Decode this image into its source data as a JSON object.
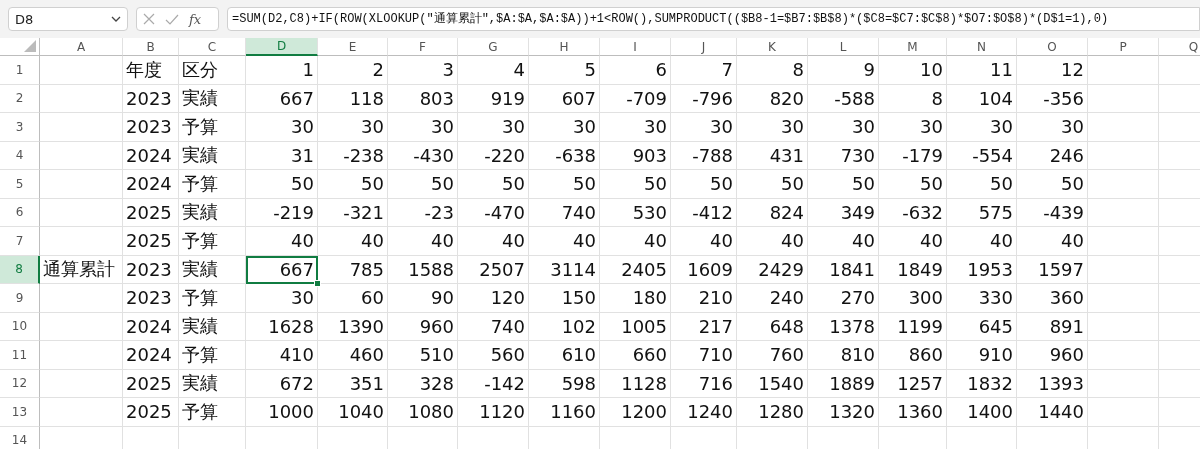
{
  "formula_bar": {
    "name_box": "D8",
    "fx": "fx",
    "formula": "=SUM(D2,C8)+IF(ROW(XLOOKUP(\"通算累計\",$A:$A,$A:$A))+1<ROW(),SUMPRODUCT(($B8-1=$B7:$B$8)*($C8=$C7:$C$8)*$O7:$O$8)*(D$1=1),0)"
  },
  "columns": [
    {
      "label": "A",
      "selected": false
    },
    {
      "label": "B",
      "selected": false
    },
    {
      "label": "C",
      "selected": false
    },
    {
      "label": "D",
      "selected": true
    },
    {
      "label": "E",
      "selected": false
    },
    {
      "label": "F",
      "selected": false
    },
    {
      "label": "G",
      "selected": false
    },
    {
      "label": "H",
      "selected": false
    },
    {
      "label": "I",
      "selected": false
    },
    {
      "label": "J",
      "selected": false
    },
    {
      "label": "K",
      "selected": false
    },
    {
      "label": "L",
      "selected": false
    },
    {
      "label": "M",
      "selected": false
    },
    {
      "label": "N",
      "selected": false
    },
    {
      "label": "O",
      "selected": false
    },
    {
      "label": "P",
      "selected": false
    },
    {
      "label": "Q",
      "selected": false
    }
  ],
  "rows": [
    {
      "row": "1",
      "selected": false,
      "B": "年度",
      "C": "区分",
      "values": [
        "1",
        "2",
        "3",
        "4",
        "5",
        "6",
        "7",
        "8",
        "9",
        "10",
        "11",
        "12"
      ]
    },
    {
      "row": "2",
      "selected": false,
      "B": "2023",
      "C": "実績",
      "values": [
        "667",
        "118",
        "803",
        "919",
        "607",
        "-709",
        "-796",
        "820",
        "-588",
        "8",
        "104",
        "-356"
      ]
    },
    {
      "row": "3",
      "selected": false,
      "B": "2023",
      "C": "予算",
      "values": [
        "30",
        "30",
        "30",
        "30",
        "30",
        "30",
        "30",
        "30",
        "30",
        "30",
        "30",
        "30"
      ]
    },
    {
      "row": "4",
      "selected": false,
      "B": "2024",
      "C": "実績",
      "values": [
        "31",
        "-238",
        "-430",
        "-220",
        "-638",
        "903",
        "-788",
        "431",
        "730",
        "-179",
        "-554",
        "246"
      ]
    },
    {
      "row": "5",
      "selected": false,
      "B": "2024",
      "C": "予算",
      "values": [
        "50",
        "50",
        "50",
        "50",
        "50",
        "50",
        "50",
        "50",
        "50",
        "50",
        "50",
        "50"
      ]
    },
    {
      "row": "6",
      "selected": false,
      "B": "2025",
      "C": "実績",
      "values": [
        "-219",
        "-321",
        "-23",
        "-470",
        "740",
        "530",
        "-412",
        "824",
        "349",
        "-632",
        "575",
        "-439"
      ]
    },
    {
      "row": "7",
      "selected": false,
      "B": "2025",
      "C": "予算",
      "values": [
        "40",
        "40",
        "40",
        "40",
        "40",
        "40",
        "40",
        "40",
        "40",
        "40",
        "40",
        "40"
      ]
    },
    {
      "row": "8",
      "selected": true,
      "A": "通算累計",
      "B": "2023",
      "C": "実績",
      "values": [
        "667",
        "785",
        "1588",
        "2507",
        "3114",
        "2405",
        "1609",
        "2429",
        "1841",
        "1849",
        "1953",
        "1597"
      ]
    },
    {
      "row": "9",
      "selected": false,
      "B": "2023",
      "C": "予算",
      "values": [
        "30",
        "60",
        "90",
        "120",
        "150",
        "180",
        "210",
        "240",
        "270",
        "300",
        "330",
        "360"
      ]
    },
    {
      "row": "10",
      "selected": false,
      "B": "2024",
      "C": "実績",
      "values": [
        "1628",
        "1390",
        "960",
        "740",
        "102",
        "1005",
        "217",
        "648",
        "1378",
        "1199",
        "645",
        "891"
      ]
    },
    {
      "row": "11",
      "selected": false,
      "B": "2024",
      "C": "予算",
      "values": [
        "410",
        "460",
        "510",
        "560",
        "610",
        "660",
        "710",
        "760",
        "810",
        "860",
        "910",
        "960"
      ]
    },
    {
      "row": "12",
      "selected": false,
      "B": "2025",
      "C": "実績",
      "values": [
        "672",
        "351",
        "328",
        "-142",
        "598",
        "1128",
        "716",
        "1540",
        "1889",
        "1257",
        "1832",
        "1393"
      ]
    },
    {
      "row": "13",
      "selected": false,
      "B": "2025",
      "C": "予算",
      "values": [
        "1000",
        "1040",
        "1080",
        "1120",
        "1160",
        "1200",
        "1240",
        "1280",
        "1320",
        "1360",
        "1400",
        "1440"
      ]
    },
    {
      "row": "14",
      "selected": false
    }
  ]
}
